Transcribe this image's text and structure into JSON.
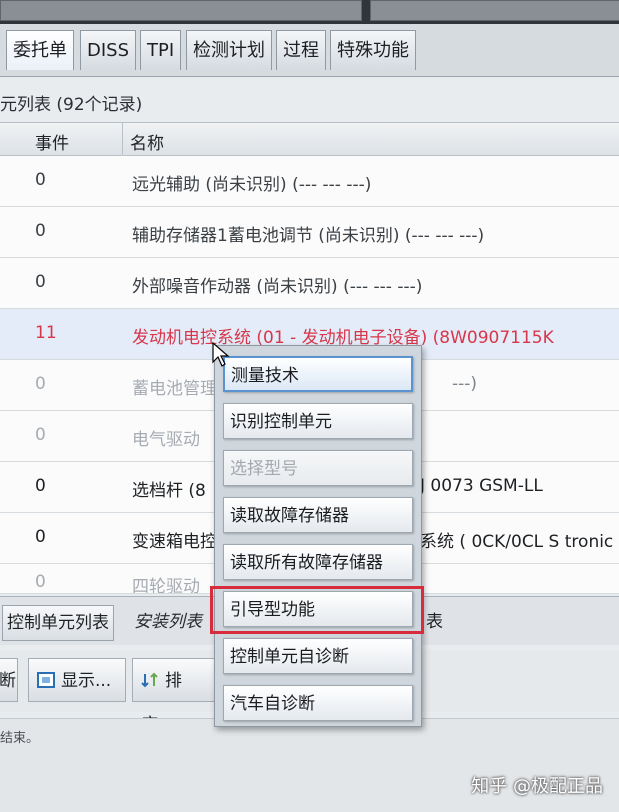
{
  "tabs": [
    "委托单",
    "DISS",
    "TPI",
    "检测计划",
    "过程",
    "特殊功能"
  ],
  "list_title": "元列表 (92个记录)",
  "columns": {
    "event": "事件",
    "name": "名称"
  },
  "rows": [
    {
      "event": "0",
      "name": "远光辅助 (尚未识别) (---  ---  ---)",
      "tail": ""
    },
    {
      "event": "0",
      "name": "辅助存储器1蓄电池调节 (尚未识别) (---  ---  ---)",
      "tail": ""
    },
    {
      "event": "0",
      "name": "外部噪音作动器 (尚未识别) (---  ---  ---)",
      "tail": ""
    },
    {
      "event": "11",
      "name": "发动机电控系统 (01 - 发动机电子设备) (8W0907115K",
      "tail": ""
    },
    {
      "event": "0",
      "name": "蓄电池管理",
      "tail": "---)"
    },
    {
      "event": "0",
      "name": "电气驱动",
      "tail": ""
    },
    {
      "event": "0",
      "name": "选档杆 (8",
      "tail": "J   0073   GSM-LL"
    },
    {
      "event": "0",
      "name": "变速箱电控",
      "tail": "系统 ( 0CK/0CL S tronic"
    },
    {
      "event": "0",
      "name": "四轮驱动",
      "tail": ""
    }
  ],
  "context_menu": [
    "测量技术",
    "识别控制单元",
    "选择型号",
    "读取故障存储器",
    "读取所有故障存储器",
    "引导型功能",
    "控制单元自诊断",
    "汽车自诊断"
  ],
  "bottom_tabs": {
    "control_unit_list": "控制单元列表",
    "install_list": "安装列表",
    "tail": "表"
  },
  "toolbar": {
    "left": "断",
    "display": "显示...",
    "sort": "排序..."
  },
  "status_text": "结束。",
  "watermark": "知乎 @极配正品"
}
